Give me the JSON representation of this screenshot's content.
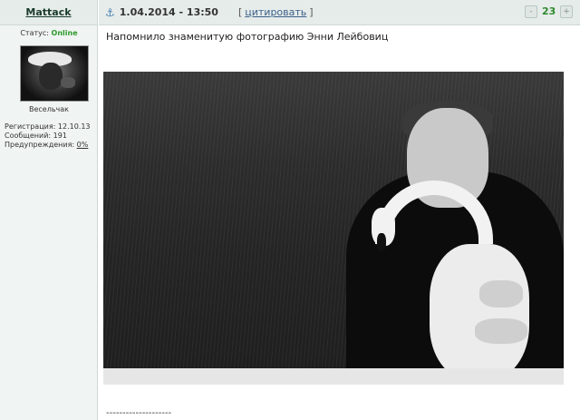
{
  "post": {
    "author": "Mattack",
    "date": "1.04.2014 - 13:50",
    "quote_open": "[",
    "quote_label": "цитировать",
    "quote_close": "]",
    "rep_minus": "-",
    "rep_count": "23",
    "rep_plus": "+",
    "message": "Напомнило знаменитую фотографию Энни Лейбовиц",
    "signature_separator": "--------------------"
  },
  "user": {
    "status_label": "Статус:",
    "status_value": "Online",
    "rank": "Весельчак",
    "registration_label": "Регистрация:",
    "registration_value": "12.10.13",
    "messages_label": "Сообщений:",
    "messages_value": "191",
    "warnings_label": "Предупреждения:",
    "warnings_value": "0%"
  },
  "icons": {
    "anchor": "anchor-icon",
    "rep_minus": "minus-icon",
    "rep_plus": "plus-icon"
  },
  "colors": {
    "header_bg": "#e6ecea",
    "online": "#2e9a2e",
    "reputation": "#2e8b2e",
    "link": "#3a5f8a"
  }
}
